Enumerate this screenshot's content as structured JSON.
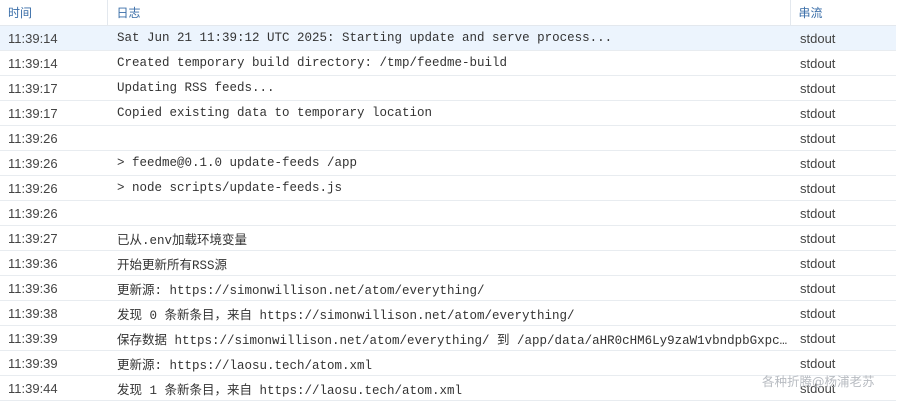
{
  "headers": {
    "time": "时间",
    "log": "日志",
    "stream": "串流"
  },
  "rows": [
    {
      "time": "11:39:14",
      "log": "Sat Jun 21 11:39:12 UTC 2025: Starting update and serve process...",
      "stream": "stdout"
    },
    {
      "time": "11:39:14",
      "log": "Created temporary build directory: /tmp/feedme-build",
      "stream": "stdout"
    },
    {
      "time": "11:39:17",
      "log": "Updating RSS feeds...",
      "stream": "stdout"
    },
    {
      "time": "11:39:17",
      "log": "Copied existing data to temporary location",
      "stream": "stdout"
    },
    {
      "time": "11:39:26",
      "log": "",
      "stream": "stdout"
    },
    {
      "time": "11:39:26",
      "log": "> feedme@0.1.0 update-feeds /app",
      "stream": "stdout"
    },
    {
      "time": "11:39:26",
      "log": "> node scripts/update-feeds.js",
      "stream": "stdout"
    },
    {
      "time": "11:39:26",
      "log": "",
      "stream": "stdout"
    },
    {
      "time": "11:39:27",
      "log": "已从.env加载环境变量",
      "stream": "stdout"
    },
    {
      "time": "11:39:36",
      "log": "开始更新所有RSS源",
      "stream": "stdout"
    },
    {
      "time": "11:39:36",
      "log": "更新源: https://simonwillison.net/atom/everything/",
      "stream": "stdout"
    },
    {
      "time": "11:39:38",
      "log": "发现 0 条新条目，来自 https://simonwillison.net/atom/everything/",
      "stream": "stdout"
    },
    {
      "time": "11:39:39",
      "log": "保存数据 https://simonwillison.net/atom/everything/ 到 /app/data/aHR0cHM6Ly9zaW1vbndpbGxpc29uL…",
      "stream": "stdout"
    },
    {
      "time": "11:39:39",
      "log": "更新源: https://laosu.tech/atom.xml",
      "stream": "stdout"
    },
    {
      "time": "11:39:44",
      "log": "发现 1 条新条目，来自 https://laosu.tech/atom.xml",
      "stream": "stdout"
    }
  ],
  "watermark": "各种折腾@杨浦老苏",
  "colors": {
    "header_text": "#3a6ea8",
    "selected_row": "#ecf4fd"
  }
}
